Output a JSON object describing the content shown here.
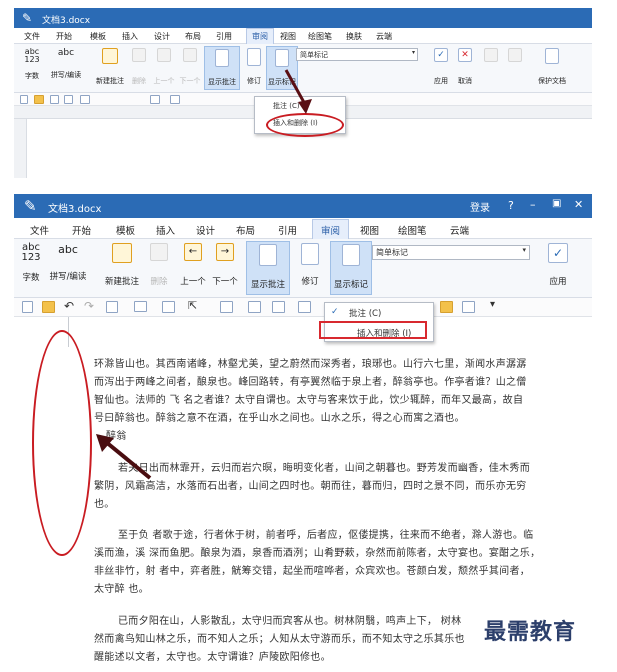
{
  "app": {
    "window_title": "文档3.docx",
    "title_icon": "pen-logo-icon",
    "title_buttons": [
      "登录",
      "?",
      "–",
      "▣",
      "✕"
    ]
  },
  "menu": [
    "文件",
    "开始",
    "模板",
    "插入",
    "设计",
    "布局",
    "引用",
    "审阅",
    "视图",
    "绘图笔",
    "换肤",
    "云端"
  ],
  "active_tab": "审阅",
  "ribbon": {
    "wordcount_icon": "abc 123",
    "wordcount": "字数",
    "spellcheck_icon": "abc",
    "spellcheck": "拼写/编读",
    "new_comment": "新建批注",
    "delete": "删除",
    "prev": "上一个",
    "next": "下一个",
    "show_comments": "显示批注",
    "track": "修订",
    "show_markup": "显示标记",
    "markup_select": "简单标记",
    "accept": "应用",
    "reject": "取消",
    "protect": "保护文档"
  },
  "dropdown": {
    "item1": "批注 (C)",
    "item2": "插入和删除 (I)"
  },
  "document": {
    "lines": [
      "环滁皆山也。其西南诸峰，林壑尤美，望之蔚然而深秀者，琅琊也。山行六七里，渐闻水声潺潺",
      "而泻出于两峰之间者，酿泉也。峰回路转，有亭翼然临于泉上者，醉翁亭也。作亭者谁？山之僧",
      "智仙也。法师的 飞 名之者谁？太守自谓也。太守与客来饮于此，饮少辄醉，而年又最高，故自",
      "号曰醉翁也。醉翁之意不在酒，在乎山水之间也。山水之乐，得之心而寓之酒也。",
      "醉翁",
      "若夫日出而林霏开，云归而岩穴暝，晦明变化者，山间之朝暮也。野芳发而幽香，佳木秀而",
      "繁阴，风霜高洁，水落而石出者，山间之四时也。朝而往，暮而归，四时之景不同，而乐亦无穷",
      "也。",
      "至于负 者歌于途，行者休于树，前者呼，后者应，伛偻提携，往来而不绝者，滁人游也。临",
      "溪而渔，溪 深而鱼肥。酿泉为酒，泉香而酒洌；山肴野蔌，杂然而前陈者，太守宴也。宴酣之乐，",
      "非丝非竹，射 者中，弈者胜，觥筹交错，起坐而喧哗者，众宾欢也。苍颜白发，颓然乎其间者，",
      "太守醉 也。",
      "已而夕阳在山，人影散乱，太守归而宾客从也。树林阴翳，鸣声上下， 树林",
      "然而禽鸟知山林之乐，而不知人之乐；人知从太守游而乐，而不知太守之乐其乐也",
      "醒能述以文者，太守也。太守谓谁？庐陵欧阳修也。"
    ]
  },
  "watermark": "最需教育"
}
